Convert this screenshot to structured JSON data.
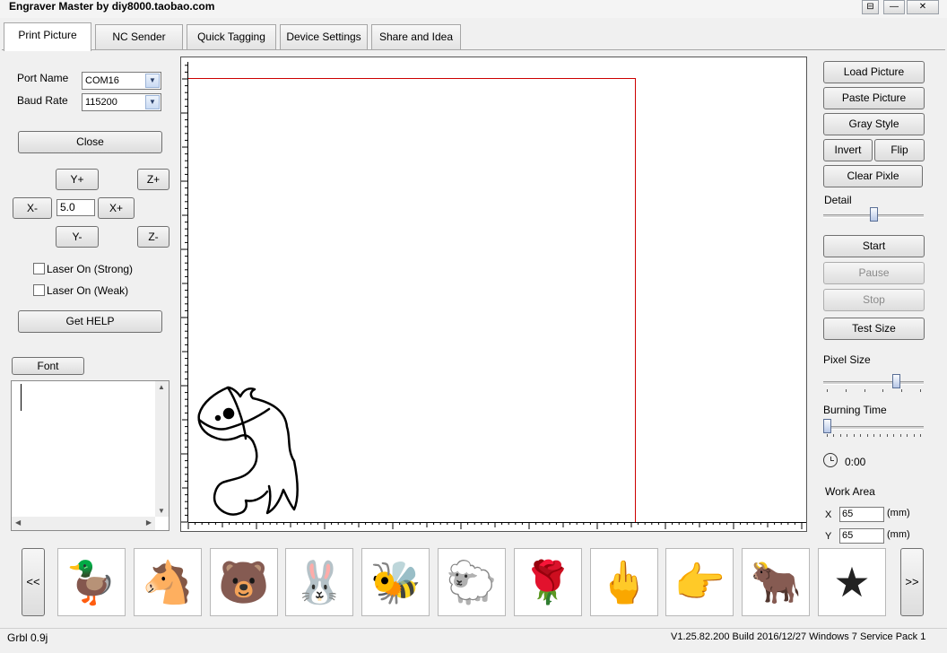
{
  "window": {
    "title": "Engraver Master by diy8000.taobao.com",
    "controls": {
      "extra": "⊟",
      "minimize": "—",
      "close": "✕"
    }
  },
  "tabs": [
    {
      "label": "Print Picture",
      "active": true
    },
    {
      "label": "NC Sender"
    },
    {
      "label": "Quick Tagging"
    },
    {
      "label": "Device Settings"
    },
    {
      "label": "Share and Idea"
    }
  ],
  "connection": {
    "port_label": "Port Name",
    "port_value": "COM16",
    "baud_label": "Baud Rate",
    "baud_value": "115200",
    "close_label": "Close"
  },
  "jog": {
    "y_plus": "Y+",
    "y_minus": "Y-",
    "x_plus": "X+",
    "x_minus": "X-",
    "z_plus": "Z+",
    "z_minus": "Z-",
    "step": "5.0"
  },
  "laser": {
    "strong": "Laser On (Strong)",
    "weak": "Laser On (Weak)"
  },
  "help_label": "Get HELP",
  "font_label": "Font",
  "right_panel": {
    "load_picture": "Load Picture",
    "paste_picture": "Paste Picture",
    "gray_style": "Gray Style",
    "invert": "Invert",
    "flip": "Flip",
    "clear_pixle": "Clear Pixle",
    "detail_label": "Detail",
    "detail_level": 0.5,
    "start": "Start",
    "pause": "Pause",
    "stop": "Stop",
    "test_size": "Test Size",
    "pixel_size_label": "Pixel Size",
    "pixel_size_level": 0.75,
    "burning_time_label": "Burning Time",
    "burning_time_level": 0.0,
    "time_value": "0:00",
    "work_area_label": "Work Area",
    "x_label": "X",
    "x_value": "65",
    "y_label": "Y",
    "y_value": "65",
    "unit": "(mm)"
  },
  "gallery": {
    "prev": "<<",
    "next": ">>",
    "items": [
      "duck-picture",
      "pony-color-picture",
      "bear-picture",
      "rabbit-soldier-picture",
      "bee-picture",
      "sheep-picture",
      "rose-picture",
      "middle-finger-picture",
      "pointing-hand-picture",
      "bull-picture",
      "star-mascot-picture"
    ]
  },
  "status": {
    "left": "Grbl 0.9j",
    "right": "V1.25.82.200 Build 2016/12/27 Windows 7 Service Pack 1"
  }
}
